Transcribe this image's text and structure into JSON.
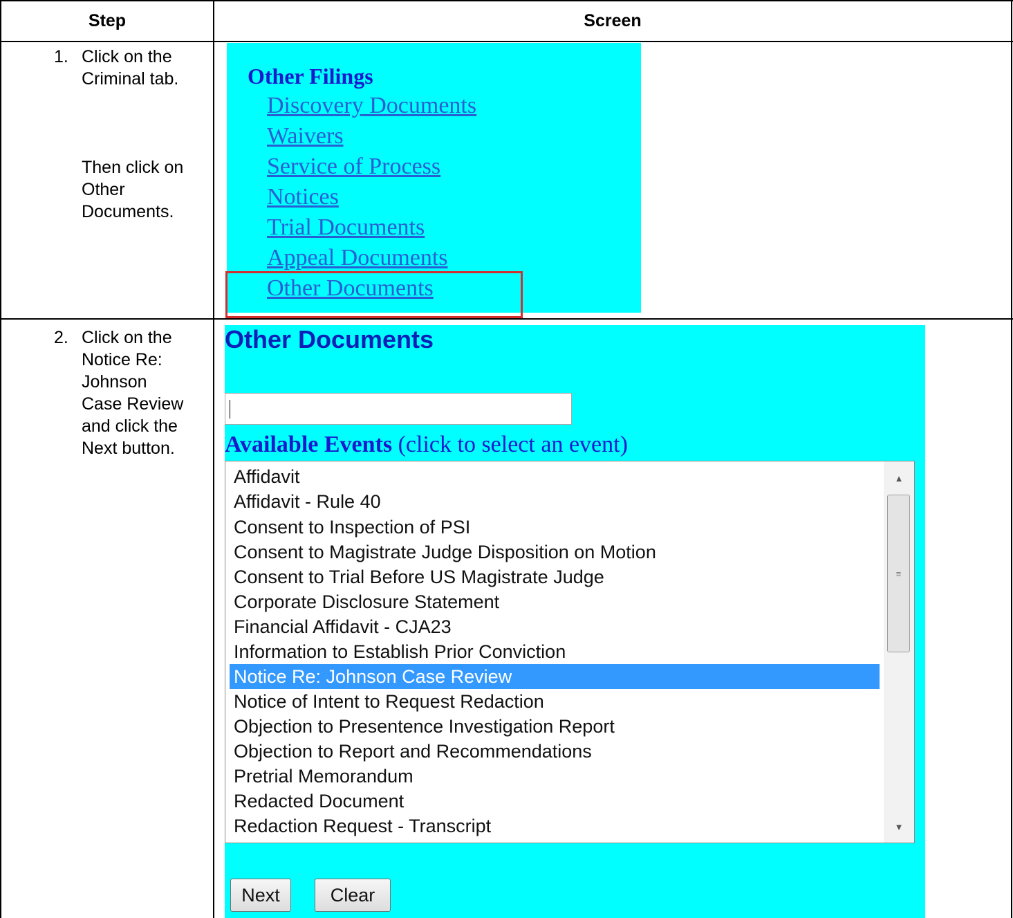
{
  "table": {
    "headers": {
      "step": "Step",
      "screen": "Screen"
    },
    "rows": [
      {
        "number": "1.",
        "instruction_a": [
          "Click on the",
          "Criminal tab."
        ],
        "instruction_b": [
          "Then click on",
          "Other",
          "Documents."
        ]
      },
      {
        "number": "2.",
        "instruction": [
          "Click on the",
          "Notice Re:",
          "Johnson",
          "Case Review",
          "and click the",
          "Next button."
        ]
      }
    ]
  },
  "other_filings": {
    "title": "Other Filings",
    "links": [
      "Discovery Documents",
      "Waivers",
      "Service of Process",
      "Notices",
      "Trial Documents",
      "Appeal Documents",
      "Other Documents"
    ],
    "highlighted": "Other Documents",
    "highlight_color": "#d32f2f",
    "bg_color": "#00ffff"
  },
  "other_documents": {
    "title": "Other Documents",
    "search_value": "",
    "available_bold": "Available Events",
    "available_hint": "(click to select an event)",
    "events": [
      "Affidavit",
      "Affidavit - Rule 40",
      "Consent to Inspection of PSI",
      "Consent to Magistrate Judge Disposition on Motion",
      "Consent to Trial Before US Magistrate Judge",
      "Corporate Disclosure Statement",
      "Financial Affidavit - CJA23",
      "Information to Establish Prior Conviction",
      "Notice Re: Johnson Case Review",
      "Notice of Intent to Request Redaction",
      "Objection to Presentence Investigation Report",
      "Objection to Report and Recommendations",
      "Pretrial Memorandum",
      "Redacted Document",
      "Redaction Request - Transcript"
    ],
    "selected_event": "Notice Re: Johnson Case Review",
    "selected_color": "#3399ff",
    "next_label": "Next",
    "clear_label": "Clear"
  }
}
